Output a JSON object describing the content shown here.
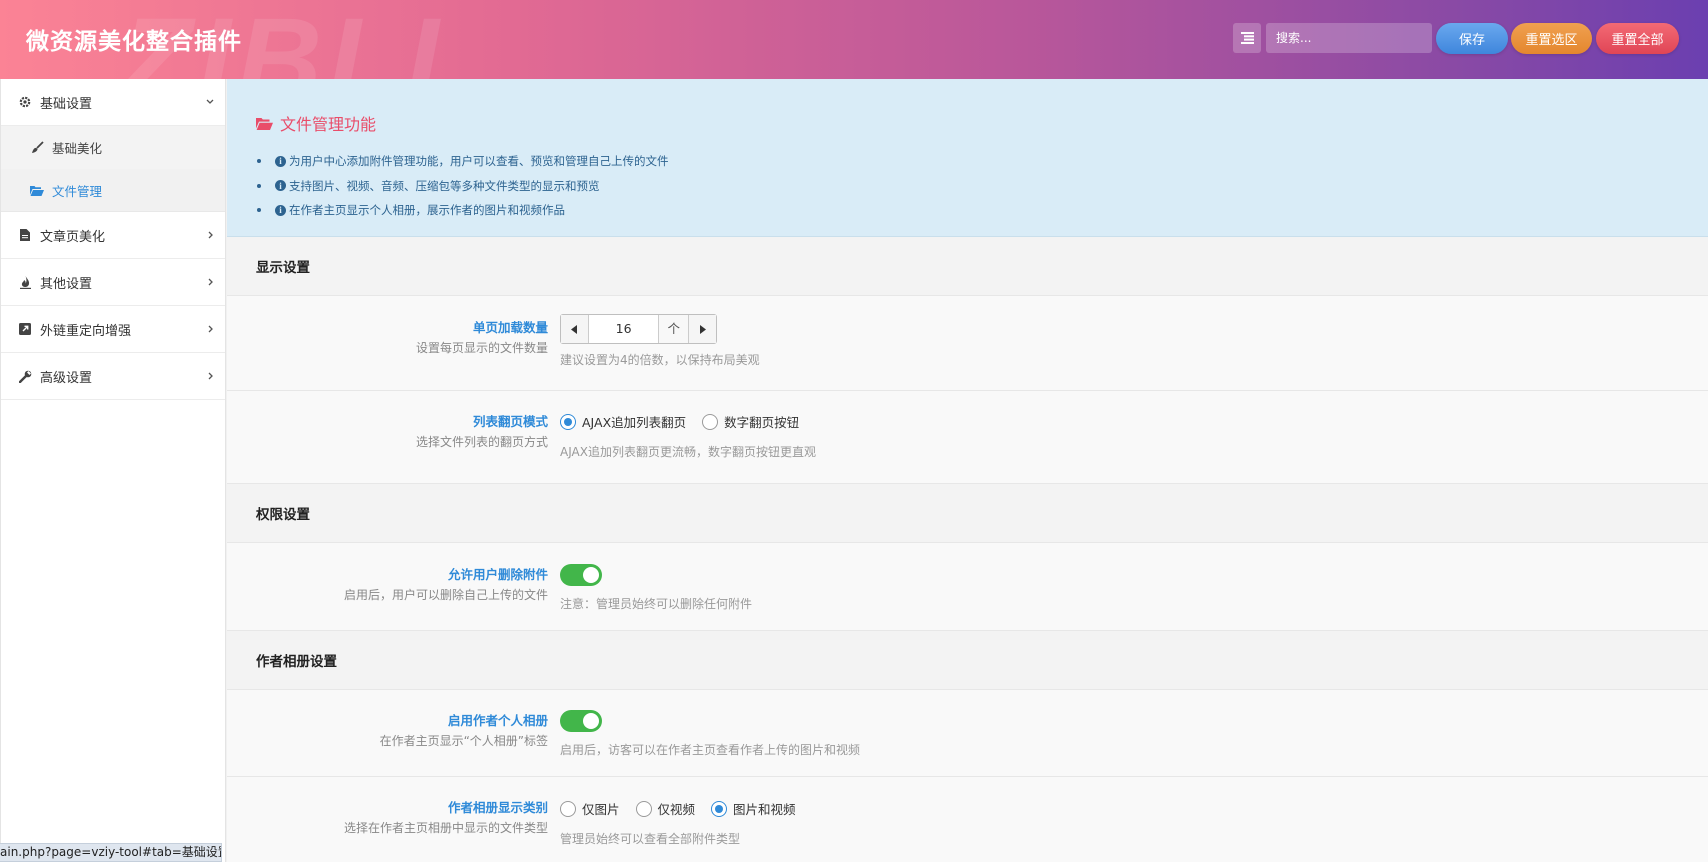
{
  "header": {
    "title": "微资源美化整合插件",
    "watermark": "ZIBLL",
    "search_placeholder": "搜索...",
    "save_label": "保存",
    "reset_section_label": "重置选区",
    "reset_all_label": "重置全部"
  },
  "sidebar": {
    "items": [
      {
        "label": "基础设置",
        "icon": "gear-icon",
        "expanded": true
      },
      {
        "label": "文章页美化",
        "icon": "file-icon"
      },
      {
        "label": "其他设置",
        "icon": "fire-icon"
      },
      {
        "label": "外链重定向增强",
        "icon": "external-link-icon"
      },
      {
        "label": "高级设置",
        "icon": "wrench-icon"
      }
    ],
    "sub_items": [
      {
        "label": "基础美化",
        "icon": "brush-icon"
      },
      {
        "label": "文件管理",
        "icon": "folder-open-icon",
        "selected": true
      }
    ]
  },
  "banner": {
    "title": "文件管理功能",
    "bullets": [
      "为用户中心添加附件管理功能，用户可以查看、预览和管理自己上传的文件",
      "支持图片、视频、音频、压缩包等多种文件类型的显示和预览",
      "在作者主页显示个人相册，展示作者的图片和视频作品"
    ]
  },
  "sections": {
    "display": "显示设置",
    "permission": "权限设置",
    "album": "作者相册设置"
  },
  "fields": {
    "per_page": {
      "title": "单页加载数量",
      "desc": "设置每页显示的文件数量",
      "value": "16",
      "unit": "个",
      "hint": "建议设置为4的倍数，以保持布局美观"
    },
    "pagination": {
      "title": "列表翻页模式",
      "desc": "选择文件列表的翻页方式",
      "options": [
        "AJAX追加列表翻页",
        "数字翻页按钮"
      ],
      "selected": 0,
      "hint": "AJAX追加列表翻页更流畅，数字翻页按钮更直观"
    },
    "allow_delete": {
      "title": "允许用户删除附件",
      "desc": "启用后，用户可以删除自己上传的文件",
      "enabled": true,
      "hint": "注意：管理员始终可以删除任何附件"
    },
    "enable_album": {
      "title": "启用作者个人相册",
      "desc": "在作者主页显示“个人相册”标签",
      "enabled": true,
      "hint": "启用后，访客可以在作者主页查看作者上传的图片和视频"
    },
    "album_types": {
      "title": "作者相册显示类别",
      "desc": "选择在作者主页相册中显示的文件类型",
      "options": [
        "仅图片",
        "仅视频",
        "图片和视频"
      ],
      "selected": 2,
      "hint": "管理员始终可以查看全部附件类型"
    }
  },
  "statusbar": {
    "url": "ain.php?page=vziy-tool#tab=基础设置"
  },
  "colors": {
    "accent_blue": "#2f8ad8",
    "accent_pink": "#e94d6a",
    "toggle_green": "#42b64a"
  }
}
